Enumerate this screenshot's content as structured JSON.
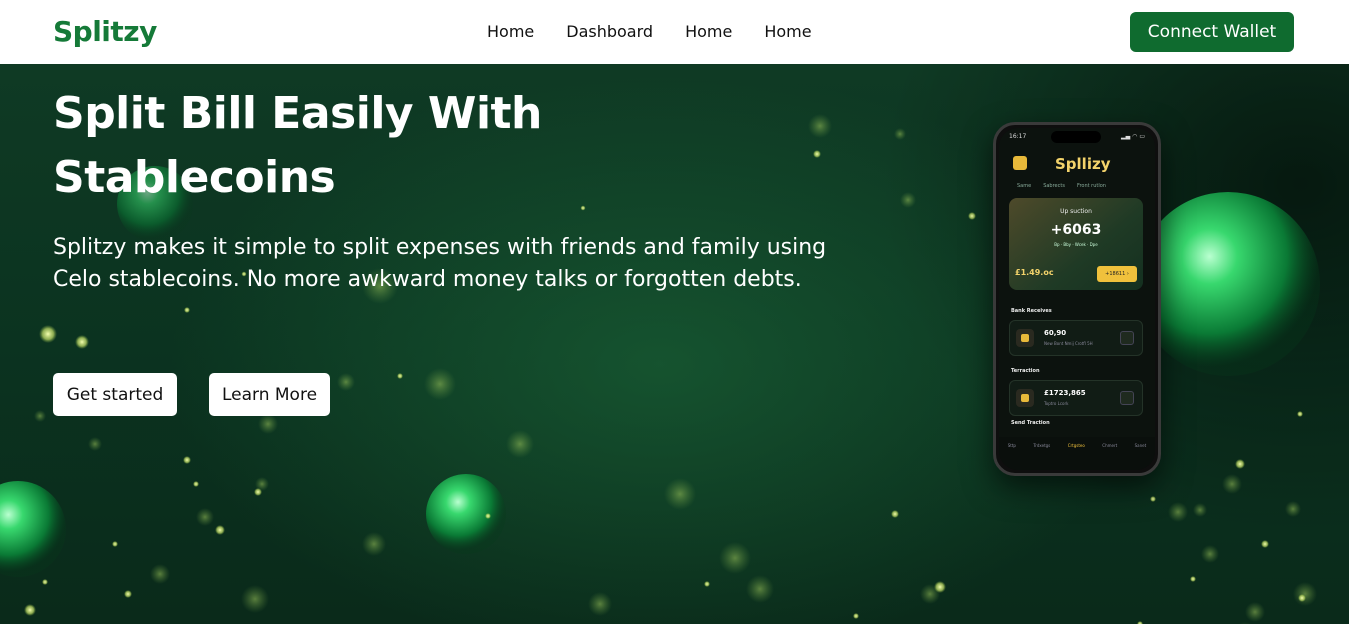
{
  "header": {
    "logo": "Splitzy",
    "nav": [
      "Home",
      "Dashboard",
      "Home",
      "Home"
    ],
    "connect_label": "Connect Wallet"
  },
  "hero": {
    "title_line1": "Split Bill Easily With",
    "title_line2": "Stablecoins",
    "description": "Splitzy makes it simple to split expenses with friends and family using Celo stablecoins. No more awkward money talks or forgotten debts.",
    "get_started": "Get started",
    "learn_more": "Learn More"
  },
  "phone": {
    "time": "16:17",
    "status": "▂▄ ◠ ▭",
    "app_name": "Spllizy",
    "tabs": [
      "Same",
      "Sabrects",
      "Front rutlon"
    ],
    "card_title": "Up suction",
    "card_amount": "+6063",
    "card_sub": "Bp · Bby · Wcek · Dpe",
    "card_left": "£1.49.oc",
    "card_btn": "+18611 ›",
    "section1": "Bank Receives",
    "row1_value": "60,90",
    "row1_note": "New Bont Nmij Crotfl 5H",
    "section2": "Terraction",
    "row2_value": "£1723,865",
    "row2_note": "Toptro Lcork",
    "section3": "Send Traction",
    "bottom_nav": [
      "Sttp",
      "Trdxetgs",
      "Crtgsteo",
      "Chmert",
      "Sanet"
    ],
    "colors": {
      "accent": "#f0c13c",
      "brand_green": "#157a38"
    }
  }
}
